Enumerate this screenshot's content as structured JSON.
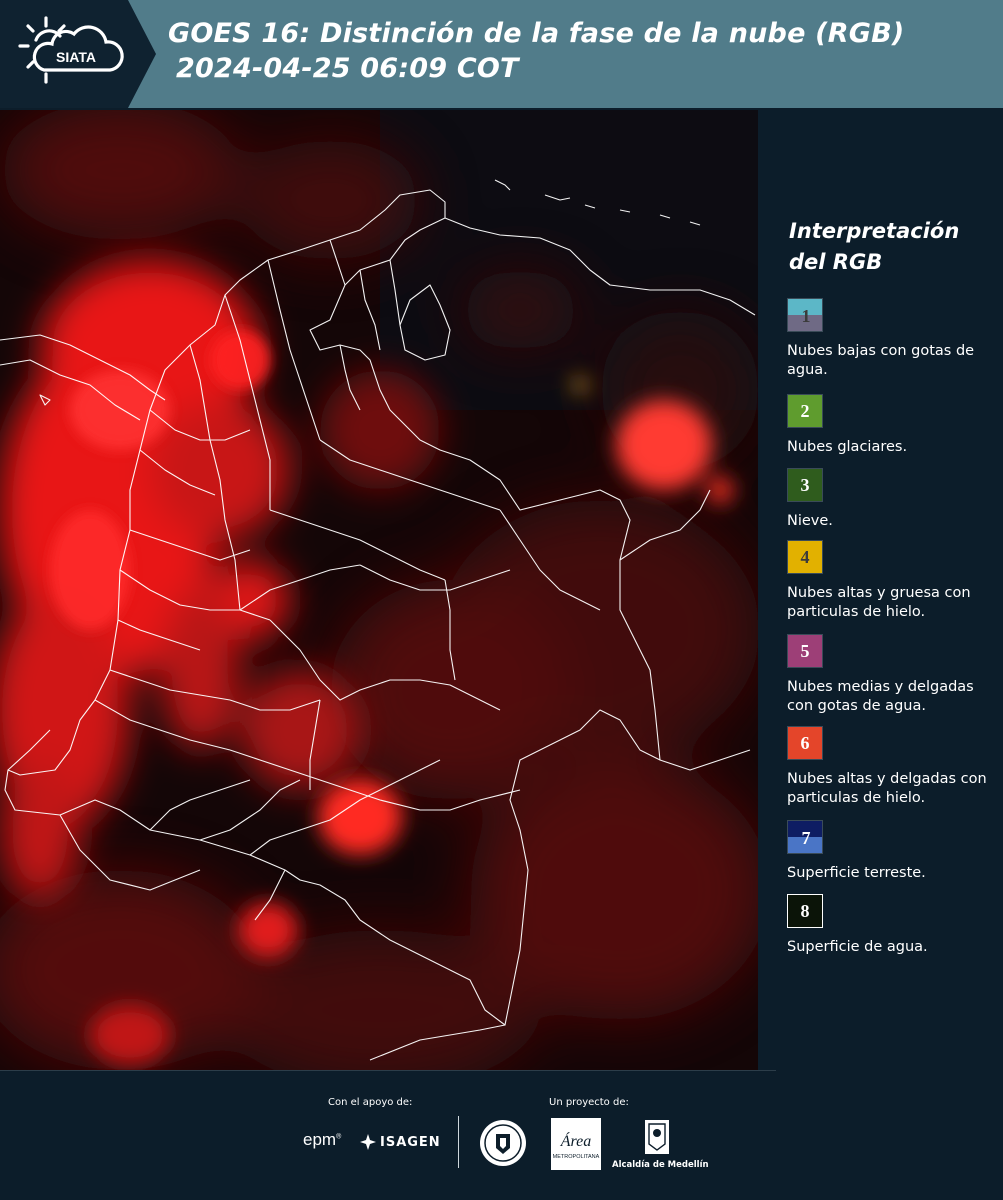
{
  "header": {
    "logo_text": "SIATA",
    "title_line1": "GOES 16: Distinción de la fase de la nube (RGB)",
    "title_line2": "2024-04-25 06:09 COT"
  },
  "legend": {
    "title_line1": "Interpretación",
    "title_line2": "del RGB",
    "items": [
      {
        "number": "1",
        "label": "Nubes bajas con gotas de agua.",
        "color_top": "#5cb7c7",
        "color_bottom": "#6f6a85",
        "number_color": "#3b3b3b"
      },
      {
        "number": "2",
        "label": "Nubes glaciares.",
        "color": "#5f9c2e",
        "number_color": "#ffffff"
      },
      {
        "number": "3",
        "label": "Nieve.",
        "color": "#2f5c1d",
        "number_color": "#ffffff"
      },
      {
        "number": "4",
        "label": "Nubes altas y gruesa con particulas de hielo.",
        "color": "#e2b100",
        "number_color": "#3b3b3b"
      },
      {
        "number": "5",
        "label": "Nubes medias y delgadas con gotas de agua.",
        "color": "#9d3f77",
        "number_color": "#ffffff"
      },
      {
        "number": "6",
        "label": "Nubes altas y delgadas con particulas de hielo.",
        "color": "#e4452a",
        "number_color": "#ffffff"
      },
      {
        "number": "7",
        "label": "Superficie terreste.",
        "color_top": "#0e1d63",
        "color_bottom": "#4a75c6",
        "number_color": "#ffffff"
      },
      {
        "number": "8",
        "label": "Superficie de agua.",
        "color": "#0b1408",
        "number_color": "#ffffff"
      }
    ]
  },
  "footer": {
    "support_label": "Con el apoyo de:",
    "project_label": "Un proyecto de:",
    "epm": "epm",
    "isagen": "ISAGEN",
    "area_logo": "Área",
    "area_sub": "METROPOLITANA",
    "medellin": "Alcaldía de Medellín"
  },
  "colors": {
    "header_bg": "#517c8a",
    "header_dark": "#0f2230",
    "panel_bg": "#0c1d2a",
    "cloud_red": "#ff1a1a",
    "boundary": "#ffffff"
  },
  "icons": [
    "sun-cloud-logo-icon",
    "isagen-star-icon",
    "university-seal-icon",
    "medellin-crest-icon"
  ]
}
